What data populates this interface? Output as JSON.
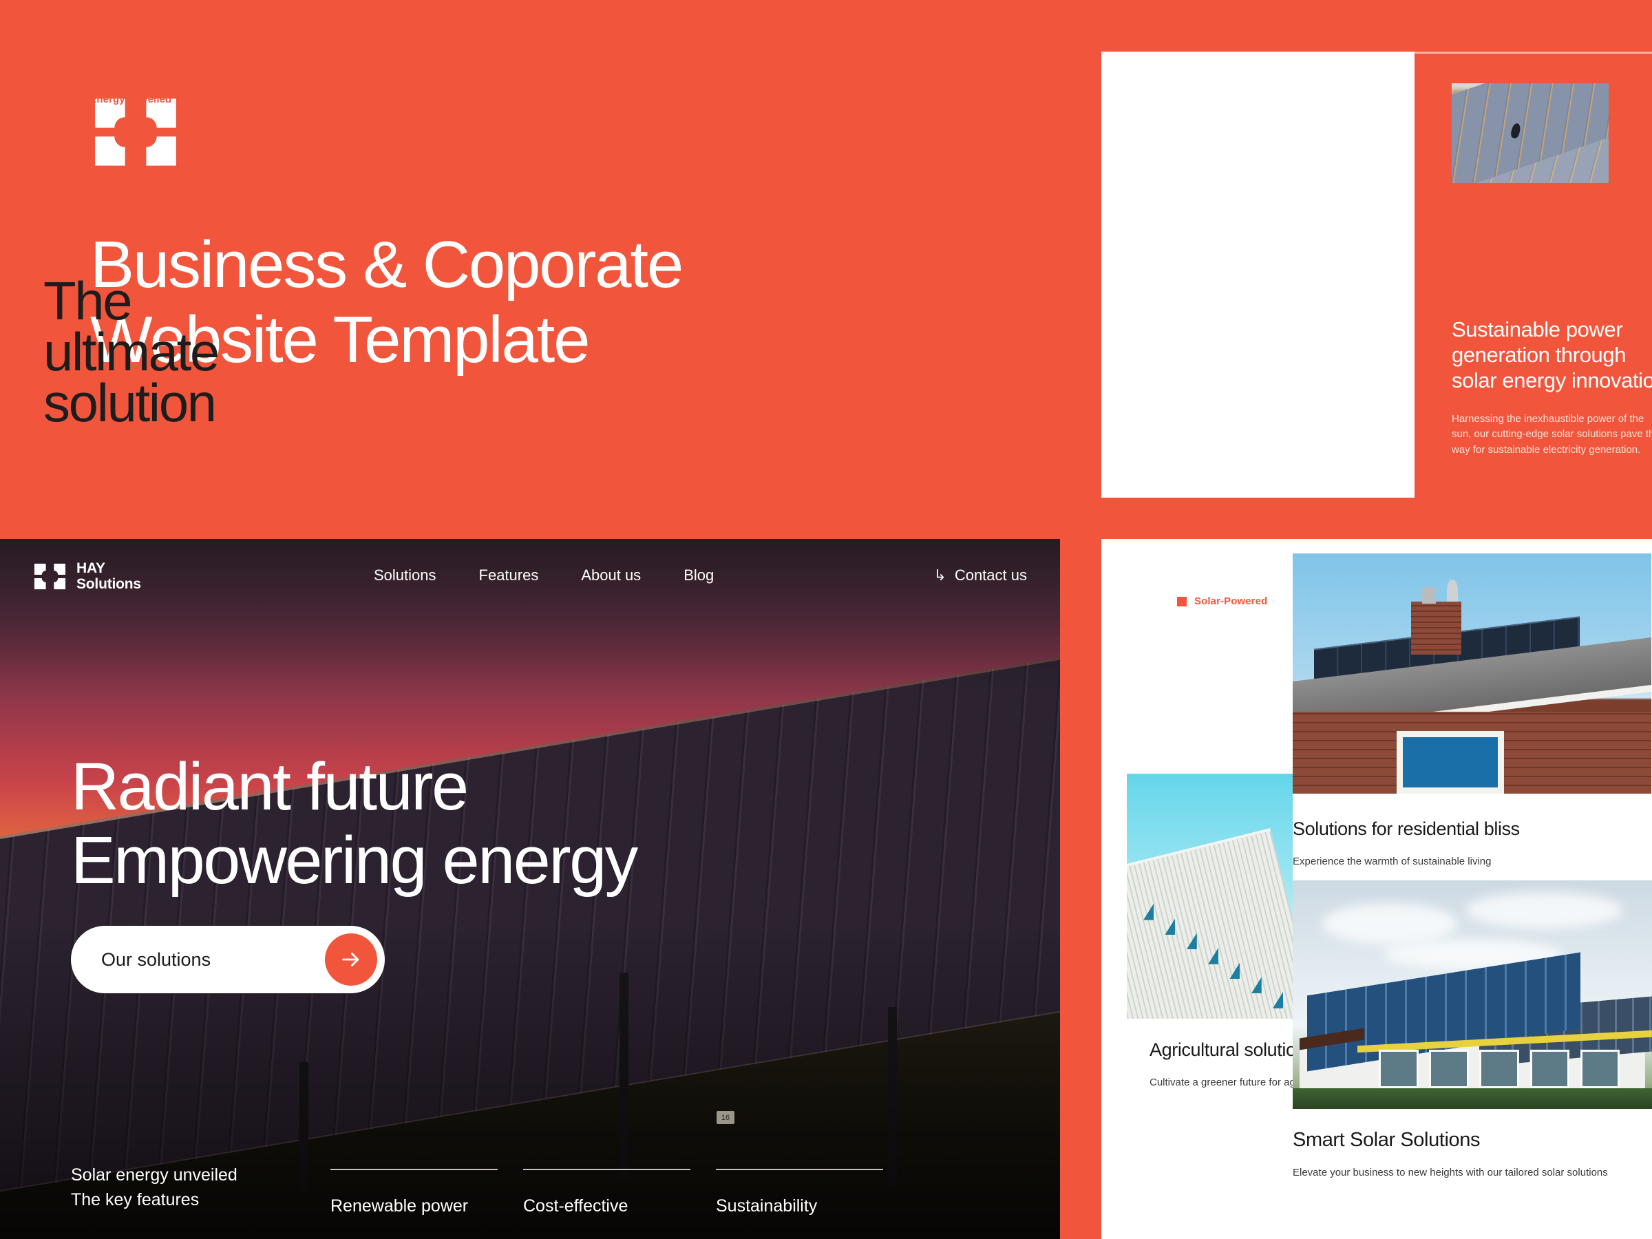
{
  "theme": {
    "accent": "#F1563C",
    "white": "#FFFFFF",
    "ink": "#1A1A1A"
  },
  "brand_panel": {
    "logo_icon": "four-squares-logo-icon",
    "title_line1": "Business & Coporate",
    "title_line2": "Website Template"
  },
  "ultimate_solution": {
    "tag": {
      "bullet_icon": "square-bullet-icon",
      "label": "Solar Energy Unveiled"
    },
    "heading_line1": "The",
    "heading_line2": "ultimate",
    "heading_line3": "solution",
    "photo_alt": "solar-panel-array-at-sunset-photo",
    "copy_heading_line1": "Sustainable power",
    "copy_heading_line2": "generation through",
    "copy_heading_line3": "solar energy innovation",
    "copy_body_line1": "Harnessing the inexhaustible power of the",
    "copy_body_line2": "sun, our cutting-edge solar solutions pave the",
    "copy_body_line3": "way for sustainable electricity generation."
  },
  "hero": {
    "logo_icon": "four-squares-logo-icon",
    "logo_line1": "HAY",
    "logo_line2": "Solutions",
    "nav_items": [
      {
        "label": "Solutions"
      },
      {
        "label": "Features"
      },
      {
        "label": "About us"
      },
      {
        "label": "Blog"
      }
    ],
    "contact": {
      "arrow_icon": "arrow-hook-icon",
      "arrow_glyph": "↳",
      "label": "Contact us"
    },
    "headline_line1": "Radiant future",
    "headline_line2": "Empowering energy",
    "cta": {
      "label": "Our solutions",
      "icon": "arrow-right-icon"
    },
    "footer": {
      "eyebrow_line1": "Solar energy unveiled",
      "eyebrow_line2": "The key features",
      "features": [
        {
          "label": "Renewable power"
        },
        {
          "label": "Cost-effective"
        },
        {
          "label": "Sustainability"
        }
      ]
    },
    "image_marker_label": "16",
    "background_alt": "solar-farm-at-dusk-photo"
  },
  "solutions": {
    "tag": {
      "bullet_icon": "square-bullet-icon",
      "label": "Solar-Powered"
    },
    "cards": [
      {
        "title": "Solutions for residential bliss",
        "subtitle": "Experience the warmth of sustainable living",
        "photo_alt": "brick-house-roof-with-solar-panels-photo"
      },
      {
        "title": "Agricultural solutions",
        "subtitle": "Cultivate a greener future for agriculture",
        "photo_alt": "corrugated-roof-with-solar-panels-blue-sky-photo"
      },
      {
        "title": "Smart Solar Solutions",
        "subtitle": "Elevate your business to new heights with our tailored solar solutions",
        "photo_alt": "large-house-with-rooftop-solar-array-photo"
      }
    ]
  }
}
